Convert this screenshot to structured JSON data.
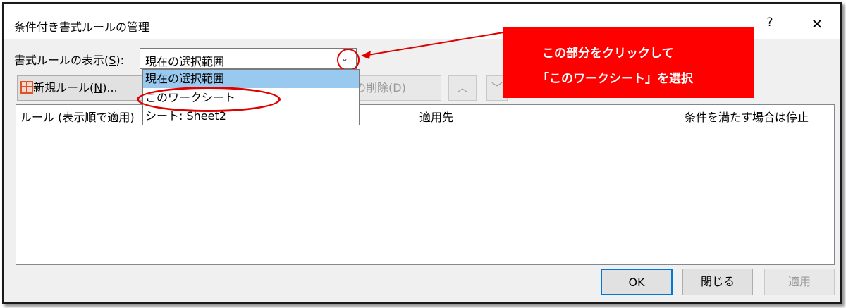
{
  "dialog": {
    "title": "条件付き書式ルールの管理",
    "help_label": "?",
    "close_label": "✕"
  },
  "show_rules": {
    "label_prefix": "書式ルールの表示(",
    "label_key": "S",
    "label_suffix": "):",
    "selected_value": "現在の選択範囲",
    "arrow_glyph": "⌄"
  },
  "dropdown": {
    "options": [
      "現在の選択範囲",
      "このワークシート",
      "シート: Sheet2"
    ],
    "highlighted_index": 0
  },
  "toolbar": {
    "new_rule_prefix": "新規ルール(",
    "new_rule_key": "N",
    "new_rule_suffix": ")...",
    "delete_rule": "ルの削除(D)",
    "up_glyph": "︿",
    "down_glyph": "﹀"
  },
  "rules_table": {
    "columns": [
      "ルール (表示順で適用)",
      "適用先",
      "条件を満たす場合は停止"
    ],
    "rows": []
  },
  "footer": {
    "ok": "OK",
    "close": "閉じる",
    "apply": "適用"
  },
  "annotation": {
    "line1": "この部分をクリックして",
    "line2": "「このワークシート」を選択",
    "color": "#ff0000"
  }
}
